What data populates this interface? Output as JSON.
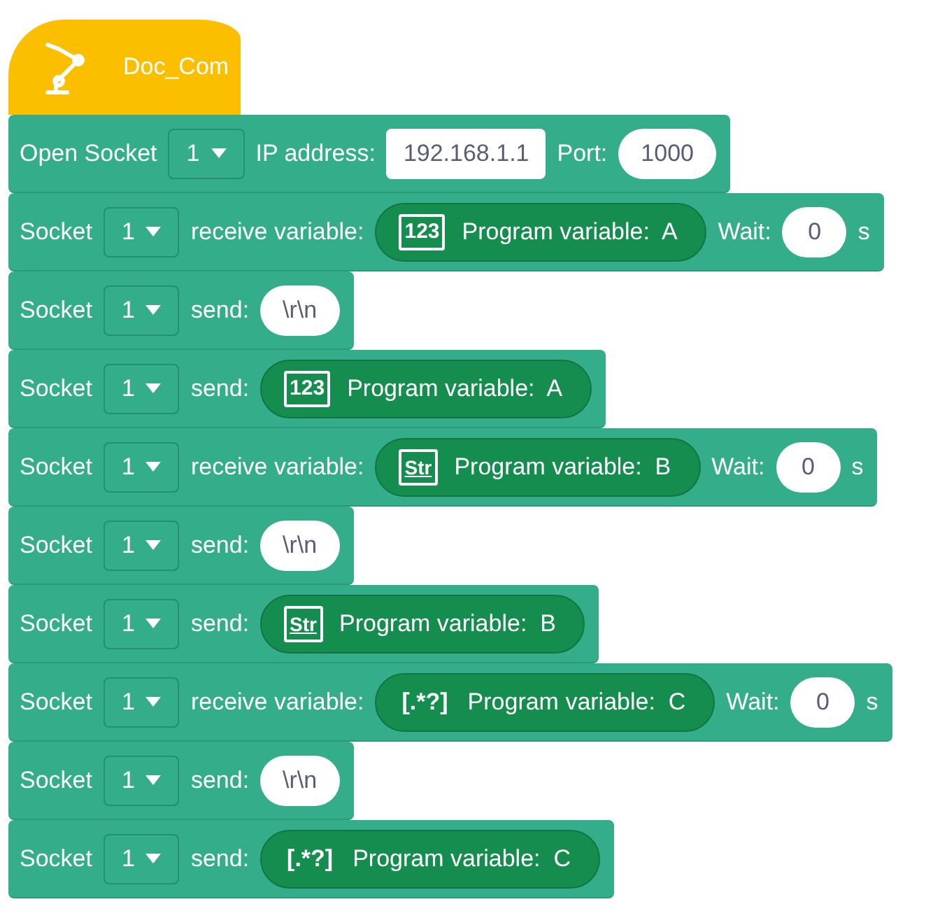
{
  "hat": {
    "title": "Doc_Com"
  },
  "blocks": [
    {
      "kind": "open",
      "label": "Open Socket",
      "socket": "1",
      "ip_label": "IP address:",
      "ip": "192.168.1.1",
      "port_label": "Port:",
      "port": "1000"
    },
    {
      "kind": "receive",
      "label": "Socket",
      "socket": "1",
      "action": "receive variable:",
      "variable": {
        "kind": "number",
        "badge": "123",
        "text": "Program variable:  A"
      },
      "wait_label": "Wait:",
      "wait": "0",
      "unit": "s"
    },
    {
      "kind": "send",
      "label": "Socket",
      "socket": "1",
      "action": "send:",
      "value": {
        "kind": "text",
        "text": "\\r\\n"
      }
    },
    {
      "kind": "send",
      "label": "Socket",
      "socket": "1",
      "action": "send:",
      "value": {
        "kind": "variable",
        "variable": {
          "kind": "number",
          "badge": "123",
          "text": "Program variable:  A"
        }
      }
    },
    {
      "kind": "receive",
      "label": "Socket",
      "socket": "1",
      "action": "receive variable:",
      "variable": {
        "kind": "string",
        "badge": "Str",
        "text": "Program variable:  B"
      },
      "wait_label": "Wait:",
      "wait": "0",
      "unit": "s"
    },
    {
      "kind": "send",
      "label": "Socket",
      "socket": "1",
      "action": "send:",
      "value": {
        "kind": "text",
        "text": "\\r\\n"
      }
    },
    {
      "kind": "send",
      "label": "Socket",
      "socket": "1",
      "action": "send:",
      "value": {
        "kind": "variable",
        "variable": {
          "kind": "string",
          "badge": "Str",
          "text": "Program variable:  B"
        }
      }
    },
    {
      "kind": "receive",
      "label": "Socket",
      "socket": "1",
      "action": "receive variable:",
      "variable": {
        "kind": "regex",
        "badge": "[.*?]",
        "text": "Program variable:  C"
      },
      "wait_label": "Wait:",
      "wait": "0",
      "unit": "s"
    },
    {
      "kind": "send",
      "label": "Socket",
      "socket": "1",
      "action": "send:",
      "value": {
        "kind": "text",
        "text": "\\r\\n"
      }
    },
    {
      "kind": "send",
      "label": "Socket",
      "socket": "1",
      "action": "send:",
      "value": {
        "kind": "variable",
        "variable": {
          "kind": "regex",
          "badge": "[.*?]",
          "text": "Program variable:  C"
        }
      }
    }
  ]
}
